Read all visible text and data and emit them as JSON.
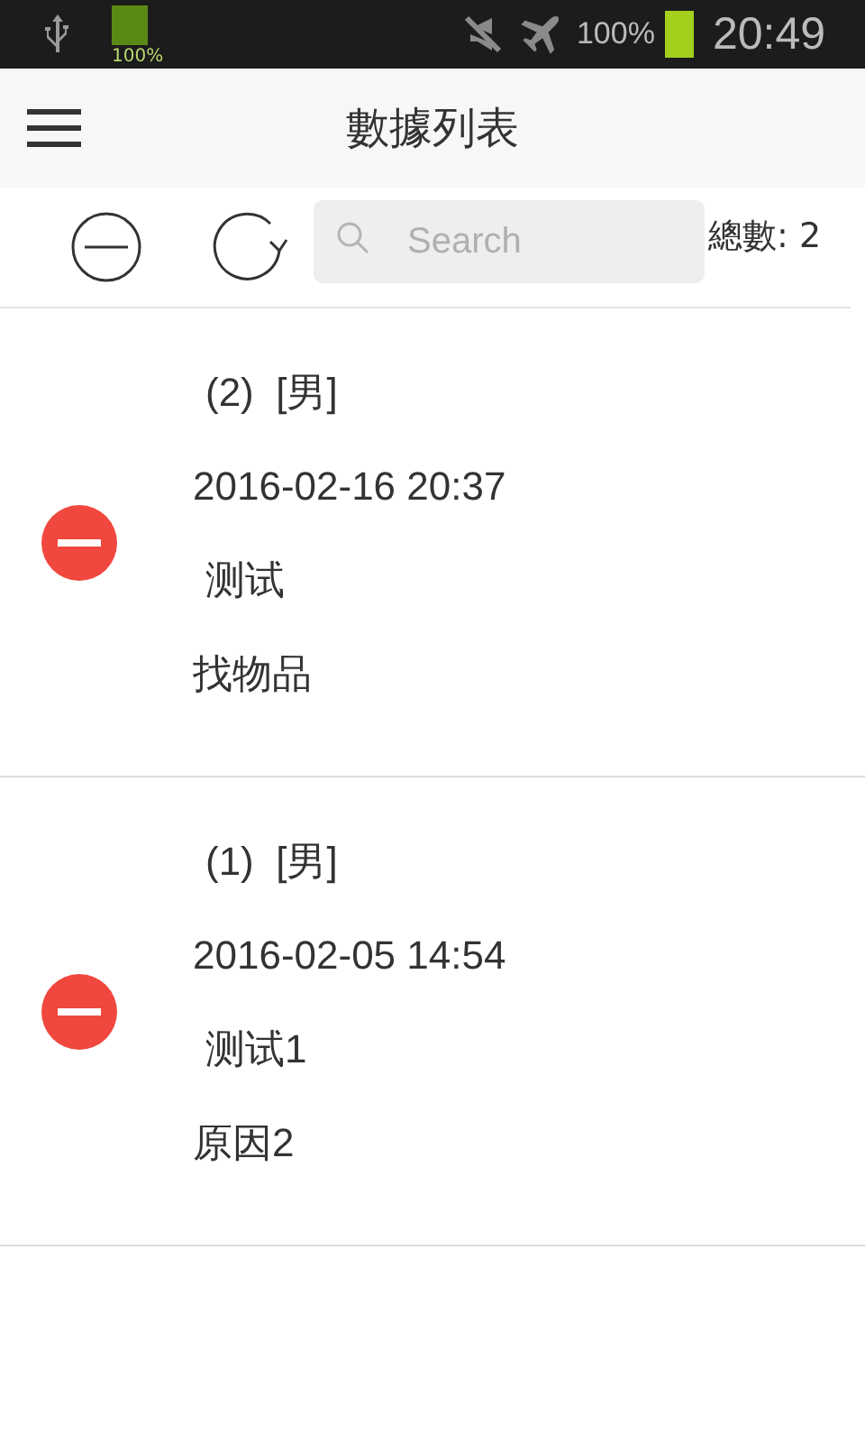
{
  "status_bar": {
    "small_battery_text": "100%",
    "battery_percent": "100%",
    "time": "20:49"
  },
  "header": {
    "title": "數據列表"
  },
  "toolbar": {
    "search": {
      "placeholder": "Search"
    },
    "total": "總數: 2"
  },
  "records": [
    {
      "title": "(2)  [男]",
      "datetime": "2016-02-16 20:37",
      "note": "测试",
      "reason": "找物品"
    },
    {
      "title": "(1)  [男]",
      "datetime": "2016-02-05 14:54",
      "note": "测试1",
      "reason": "原因2"
    }
  ]
}
